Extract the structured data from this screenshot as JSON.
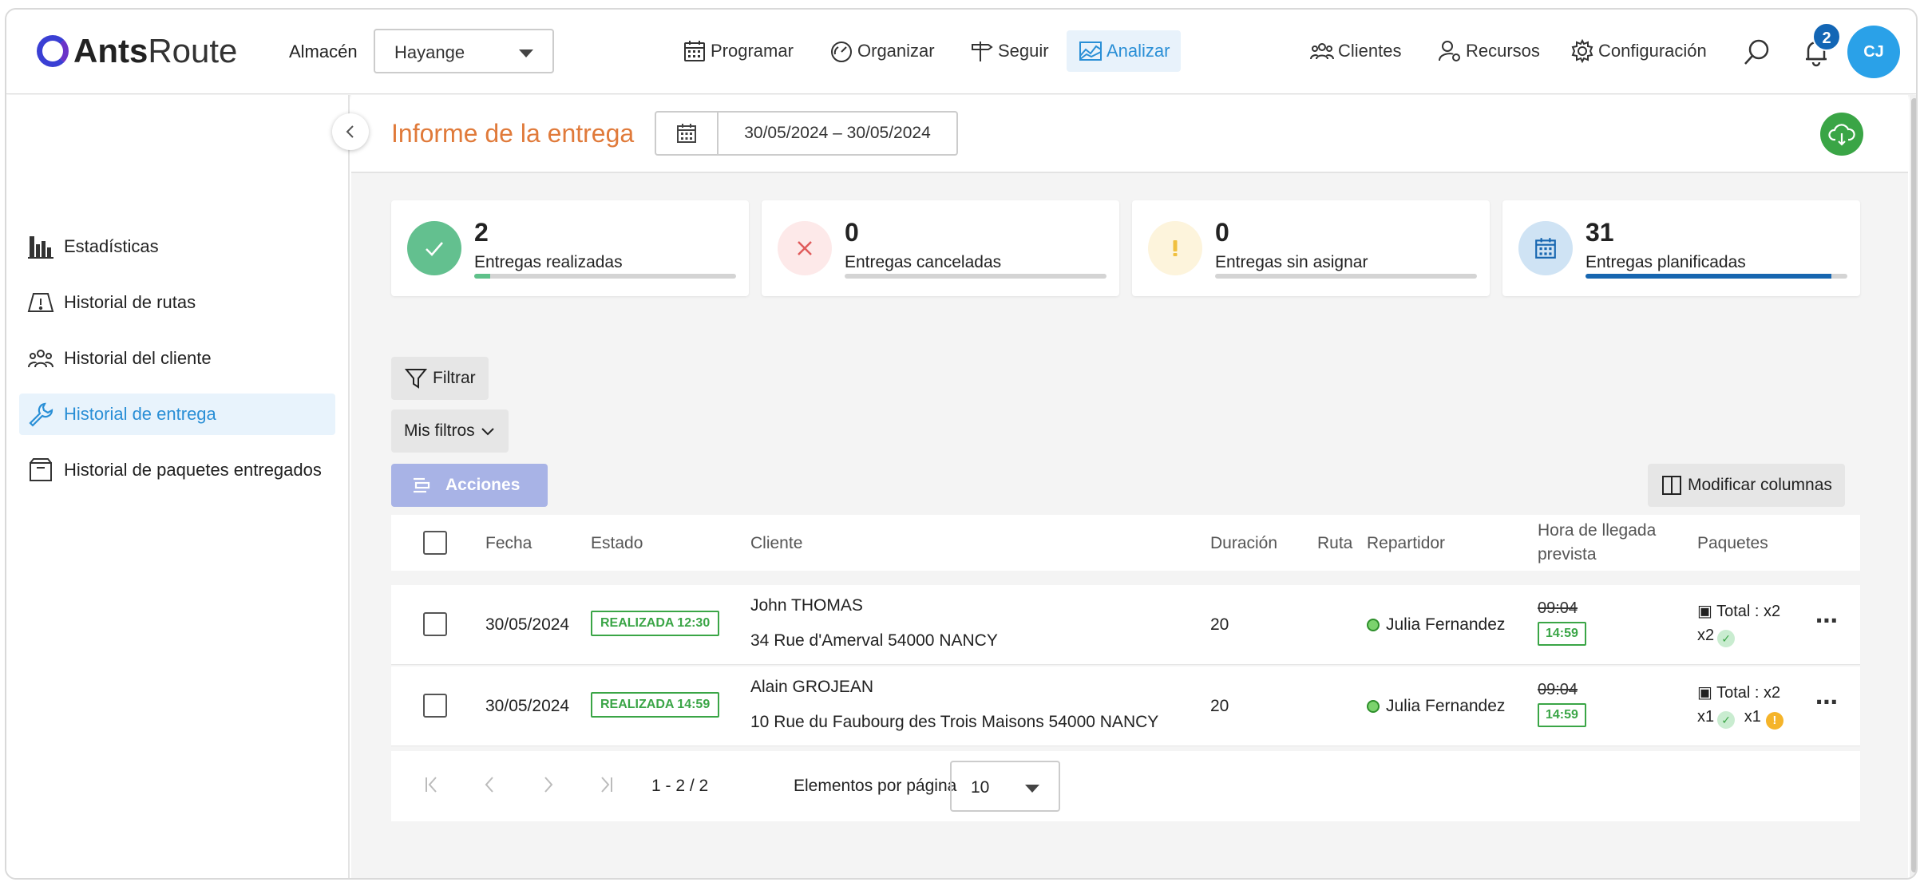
{
  "app": {
    "logo_bold": "Ants",
    "logo_light": "Route"
  },
  "header": {
    "warehouse_label": "Almacén",
    "warehouse_value": "Hayange",
    "nav": [
      {
        "label": "Programar",
        "icon": "calendar-icon"
      },
      {
        "label": "Organizar",
        "icon": "gauge-icon"
      },
      {
        "label": "Seguir",
        "icon": "signpost-icon"
      },
      {
        "label": "Analizar",
        "icon": "chart-icon",
        "active": true
      },
      {
        "label": "Clientes",
        "icon": "people-icon"
      },
      {
        "label": "Recursos",
        "icon": "user-gear-icon"
      },
      {
        "label": "Configuración",
        "icon": "gear-icon"
      }
    ],
    "notifications_count": "2",
    "avatar_initials": "CJ"
  },
  "sidebar": {
    "items": [
      {
        "label": "Estadísticas",
        "icon": "bar-chart-icon"
      },
      {
        "label": "Historial de rutas",
        "icon": "map-icon"
      },
      {
        "label": "Historial del cliente",
        "icon": "people-icon"
      },
      {
        "label": "Historial de entrega",
        "icon": "wrench-icon",
        "active": true
      },
      {
        "label": "Historial de paquetes entregados",
        "icon": "box-icon"
      }
    ]
  },
  "main": {
    "title": "Informe de la entrega",
    "date_range": "30/05/2024 – 30/05/2024",
    "cards": [
      {
        "value": "2",
        "label": "Entregas realizadas",
        "progress": 0.06,
        "color": "#5fc18a"
      },
      {
        "value": "0",
        "label": "Entregas canceladas",
        "progress": 0,
        "color": "#e05a5a"
      },
      {
        "value": "0",
        "label": "Entregas sin asignar",
        "progress": 0,
        "color": "#f0c040"
      },
      {
        "value": "31",
        "label": "Entregas planificadas",
        "progress": 0.94,
        "color": "#1766b0"
      }
    ],
    "filter_label": "Filtrar",
    "my_filters_label": "Mis filtros",
    "actions_label": "Acciones",
    "modify_columns_label": "Modificar columnas",
    "table": {
      "columns": [
        "Fecha",
        "Estado",
        "Cliente",
        "Duración",
        "Ruta",
        "Repartidor",
        "Hora de llegada",
        "prevista",
        "Paquetes"
      ],
      "rows": [
        {
          "date": "30/05/2024",
          "status": "REALIZADA 12:30",
          "client": "John THOMAS",
          "address": "34 Rue d'Amerval 54000 NANCY",
          "duration": "20",
          "driver": "Julia Fernandez",
          "planned": "09:04",
          "actual": "14:59",
          "pkg_total": "Total : x2",
          "pkg_ok": "x2",
          "pkg_warn": ""
        },
        {
          "date": "30/05/2024",
          "status": "REALIZADA 14:59",
          "client": "Alain GROJEAN",
          "address": "10 Rue du Faubourg des Trois Maisons 54000 NANCY",
          "duration": "20",
          "driver": "Julia Fernandez",
          "planned": "09:04",
          "actual": "14:59",
          "pkg_total": "Total : x2",
          "pkg_ok": "x1",
          "pkg_warn": "x1"
        }
      ]
    },
    "pagination": {
      "range": "1 - 2 / 2",
      "per_page_label": "Elementos por página",
      "per_page_value": "10"
    }
  }
}
